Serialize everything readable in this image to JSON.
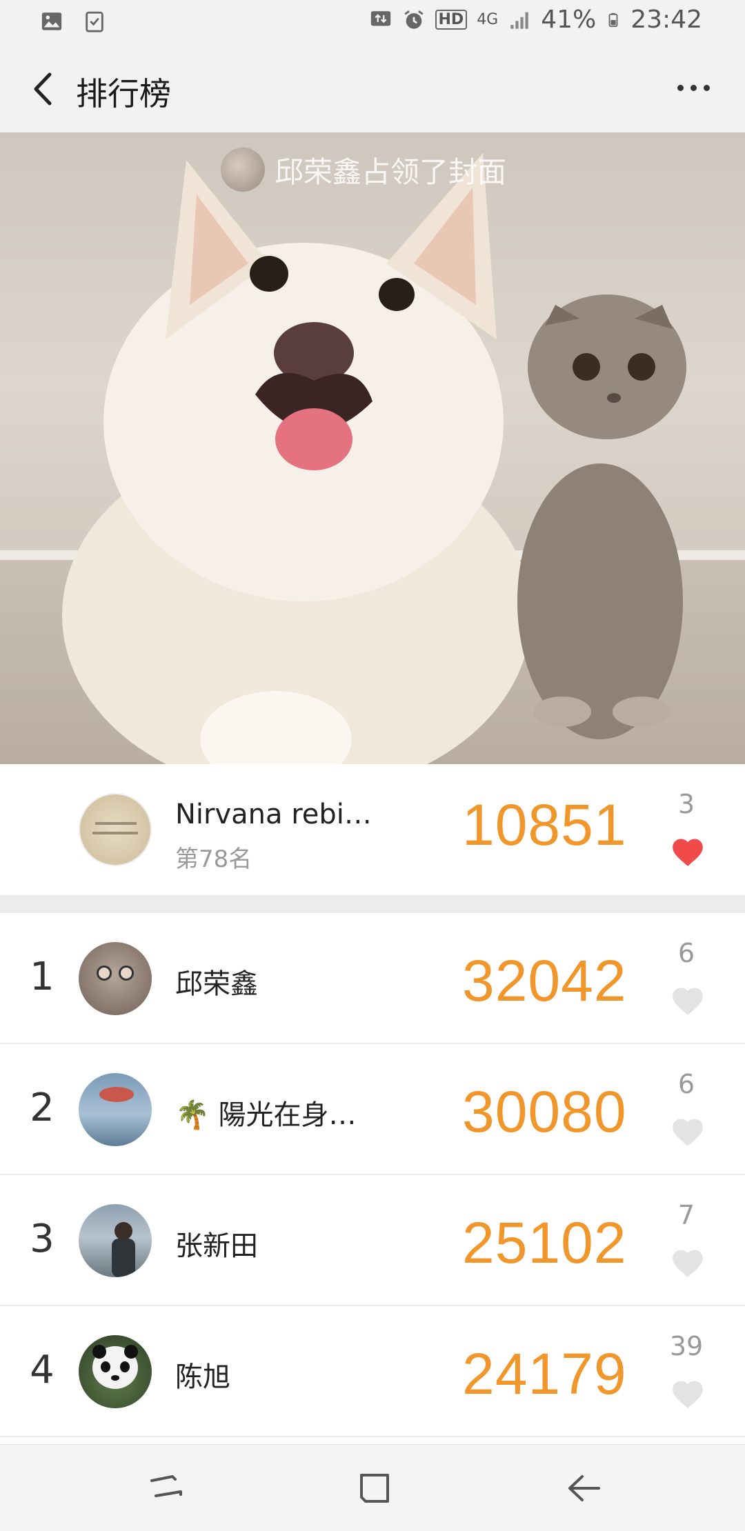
{
  "status_bar": {
    "battery": "41%",
    "time": "23:42",
    "network": "4G",
    "hd_label": "HD"
  },
  "header": {
    "title": "排行榜"
  },
  "cover": {
    "caption": "邱荣鑫占领了封面"
  },
  "my_entry": {
    "name": "Nirvana rebi…",
    "rank_text": "第78名",
    "steps": "10851",
    "likes": "3",
    "liked": true
  },
  "ranking": [
    {
      "rank": "1",
      "name": "邱荣鑫",
      "steps": "32042",
      "likes": "6",
      "liked": false
    },
    {
      "rank": "2",
      "name": "🌴 陽光在身…",
      "steps": "30080",
      "likes": "6",
      "liked": false
    },
    {
      "rank": "3",
      "name": "张新田",
      "steps": "25102",
      "likes": "7",
      "liked": false
    },
    {
      "rank": "4",
      "name": "陈旭",
      "steps": "24179",
      "likes": "39",
      "liked": false
    }
  ],
  "colors": {
    "steps": "#f0962a",
    "heart_active": "#f04a4a",
    "heart_inactive": "#e3e3e3"
  }
}
